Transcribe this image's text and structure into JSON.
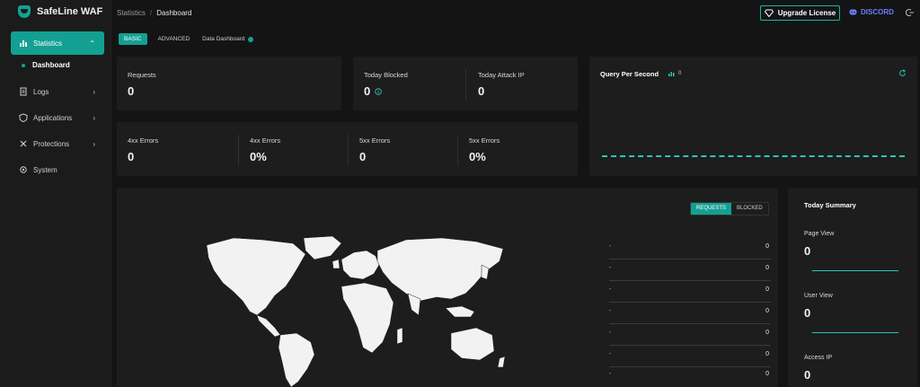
{
  "app": {
    "name": "SafeLine WAF"
  },
  "sidebar": {
    "items": [
      {
        "label": "Statistics",
        "icon": "bar-chart-icon",
        "active": true
      },
      {
        "label": "Logs",
        "icon": "document-icon"
      },
      {
        "label": "Applications",
        "icon": "shield-icon"
      },
      {
        "label": "Protections",
        "icon": "tools-icon"
      },
      {
        "label": "System",
        "icon": "gear-icon"
      }
    ],
    "sub_item": "Dashboard"
  },
  "breadcrumb": {
    "parent": "Statistics",
    "separator": "/",
    "current": "Dashboard"
  },
  "header": {
    "upgrade_label": "Upgrade License",
    "discord_label": "DISCORD"
  },
  "tabs": {
    "basic": "BASIC",
    "advanced": "ADVANCED",
    "data_dashboard": "Data Dashboard"
  },
  "metrics": {
    "requests": {
      "label": "Requests",
      "value": "0"
    },
    "today_blocked": {
      "label": "Today Blocked",
      "value": "0"
    },
    "today_attack_ip": {
      "label": "Today Attack IP",
      "value": "0"
    },
    "errors": [
      {
        "label": "4xx Errors",
        "value": "0"
      },
      {
        "label": "4xx Errors",
        "value": "0%"
      },
      {
        "label": "5xx Errors",
        "value": "0"
      },
      {
        "label": "5xx Errors",
        "value": "0%"
      }
    ]
  },
  "qps": {
    "title": "Query Per Second",
    "value": "0"
  },
  "map": {
    "toggle": {
      "requests": "REQUESTS",
      "blocked": "BLOCKED"
    },
    "rows": [
      {
        "key": "-",
        "value": "0"
      },
      {
        "key": "-",
        "value": "0"
      },
      {
        "key": "-",
        "value": "0"
      },
      {
        "key": "-",
        "value": "0"
      },
      {
        "key": "-",
        "value": "0"
      },
      {
        "key": "-",
        "value": "0"
      },
      {
        "key": "-",
        "value": "0"
      }
    ]
  },
  "summary": {
    "title": "Today Summary",
    "page_view": {
      "label": "Page View",
      "value": "0"
    },
    "user_view": {
      "label": "User View",
      "value": "0"
    },
    "access_ip": {
      "label": "Access IP",
      "value": "0"
    }
  },
  "colors": {
    "accent": "#13a093",
    "discord": "#6a7dff",
    "background": "#141414",
    "card": "#1d1d1d"
  }
}
